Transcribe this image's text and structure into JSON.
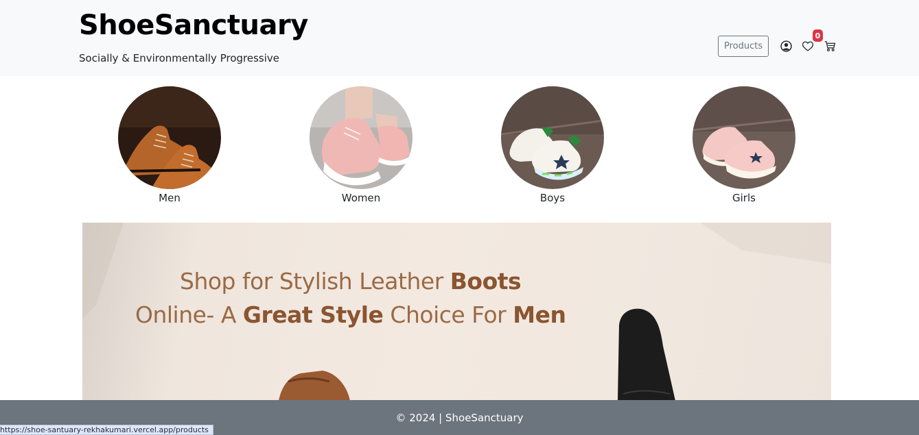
{
  "header": {
    "brand": "ShoeSanctuary",
    "tagline": "Socially & Environmentally Progressive",
    "products_label": "Products",
    "cart_count": "0"
  },
  "categories": [
    {
      "label": "Men"
    },
    {
      "label": "Women"
    },
    {
      "label": "Boys"
    },
    {
      "label": "Girls"
    }
  ],
  "banner": {
    "line1_a": "Shop for Stylish Leather ",
    "line1_b": "Boots",
    "line2_a": "Online- A ",
    "line2_b": "Great Style",
    "line2_c": " Choice For ",
    "line2_d": "Men"
  },
  "footer": {
    "text": "© 2024 | ShoeSanctuary"
  },
  "status_bar": {
    "url": "https://shoe-santuary-rekhakumari.vercel.app/products"
  },
  "colors": {
    "navbar_bg": "#f8f9fa",
    "footer_bg": "#6c757d",
    "badge": "#dc3545",
    "banner_text": "#9b6a44"
  }
}
